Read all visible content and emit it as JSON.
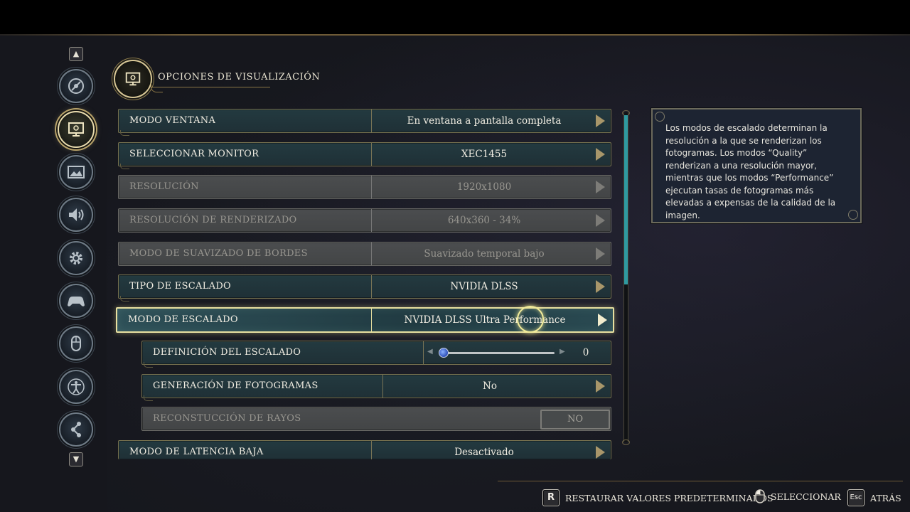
{
  "header": {
    "title": "OPCIONES DE VISUALIZACIÓN"
  },
  "sidebar": {
    "items": [
      {
        "icon": "game-disc-icon"
      },
      {
        "icon": "display-monitor-icon",
        "active": true
      },
      {
        "icon": "graphics-image-icon"
      },
      {
        "icon": "audio-speaker-icon"
      },
      {
        "icon": "settings-gear-icon"
      },
      {
        "icon": "gamepad-icon"
      },
      {
        "icon": "mouse-icon"
      },
      {
        "icon": "accessibility-icon"
      },
      {
        "icon": "network-icon"
      }
    ]
  },
  "settings": [
    {
      "label": "MODO VENTANA",
      "value": "En ventana a pantalla completa"
    },
    {
      "label": "SELECCIONAR MONITOR",
      "value": "XEC1455"
    },
    {
      "label": "RESOLUCIÓN",
      "value": "1920x1080"
    },
    {
      "label": "RESOLUCIÓN DE RENDERIZADO",
      "value": "640x360 - 34%"
    },
    {
      "label": "MODO DE SUAVIZADO DE BORDES",
      "value": "Suavizado temporal bajo"
    },
    {
      "label": "TIPO DE ESCALADO",
      "value": "NVIDIA DLSS"
    },
    {
      "label": "MODO DE ESCALADO",
      "value": "NVIDIA DLSS Ultra Performance"
    },
    {
      "label": "DEFINICIÓN DEL ESCALADO",
      "value": "0",
      "slider_fraction": 0.0
    },
    {
      "label": "GENERACIÓN DE FOTOGRAMAS",
      "value": "No"
    },
    {
      "label": "RECONSTUCCIÓN DE RAYOS",
      "value": "NO"
    },
    {
      "label": "MODO DE LATENCIA BAJA",
      "value": "Desactivado"
    }
  ],
  "info_panel": {
    "text": "Los modos de escalado determinan la resolución a la que se renderizan los fotogramas. Los modos “Quality” renderizan a una resolución mayor, mientras que los modos “Performance” ejecutan tasas de fotogramas más elevadas a expensas de la calidad de la imagen."
  },
  "footer": {
    "restore": {
      "key": "R",
      "label": "RESTAURAR VALORES PREDETERMINADOS"
    },
    "select": {
      "label": "SELECCIONAR"
    },
    "back": {
      "key": "Esc",
      "label": "ATRÁS"
    }
  },
  "colors": {
    "accent_gold": "#e8e0a0",
    "row_teal": "#233a40",
    "scroll_teal": "#2f9aa0"
  }
}
